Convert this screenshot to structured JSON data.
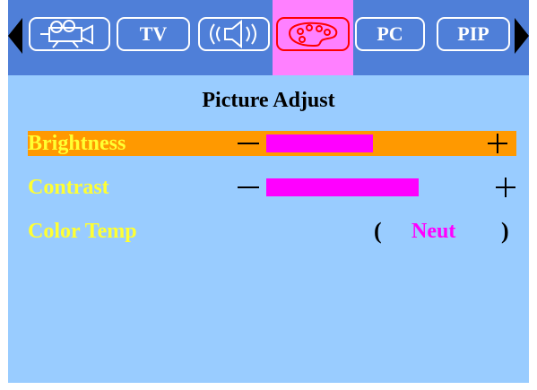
{
  "menu": {
    "tabs": [
      {
        "id": "movie",
        "icon": "film-camera-icon"
      },
      {
        "id": "tv",
        "label": "TV"
      },
      {
        "id": "sound",
        "icon": "speaker-sound-icon"
      },
      {
        "id": "picture",
        "icon": "palette-icon",
        "selected": true
      },
      {
        "id": "pc",
        "label": "PC"
      },
      {
        "id": "pip",
        "label": "PIP"
      }
    ],
    "nav_left_icon": "triangle-left-icon",
    "nav_right_icon": "triangle-right-icon"
  },
  "page": {
    "title": "Picture Adjust",
    "settings": [
      {
        "label": "Brightness",
        "level": 0.7,
        "minus_icon": "minus-icon",
        "plus_icon": "plus-icon",
        "highlighted": true
      },
      {
        "label": "Contrast",
        "level": 1.0,
        "minus_icon": "minus-icon",
        "plus_icon": "plus-icon"
      },
      {
        "label": "Color Temp",
        "value": "Neut",
        "open": "(",
        "close": ")"
      }
    ]
  },
  "colors": {
    "background": "#99ccff",
    "tabbar": "#4f7fd8",
    "selected_tab": "#ff80ff",
    "highlight_row": "#ff9900",
    "label": "#ffff33",
    "bar_fill": "#ff00ff"
  }
}
